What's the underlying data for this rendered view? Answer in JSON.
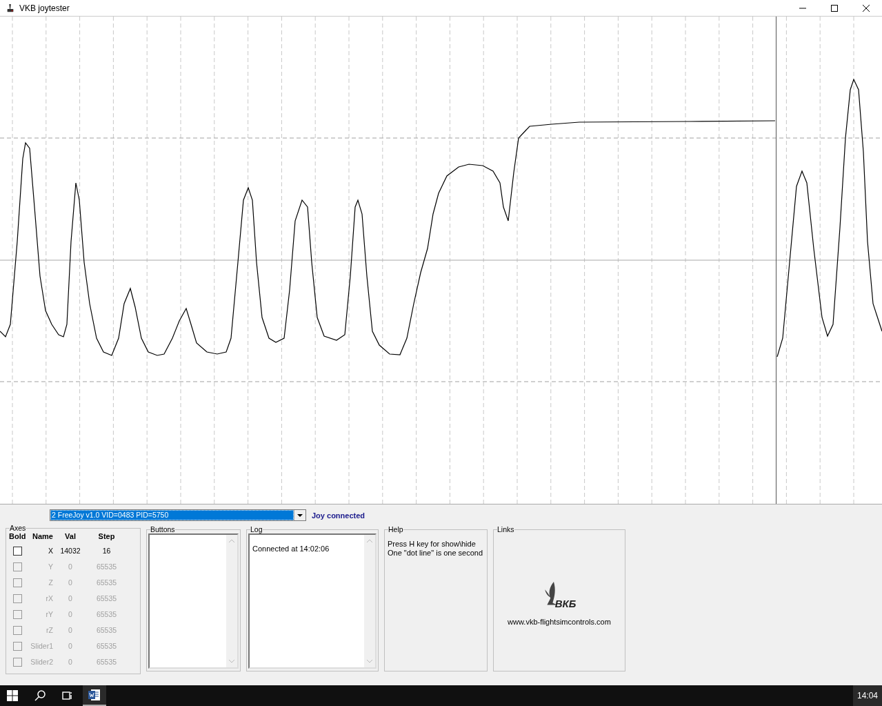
{
  "window": {
    "title": "VKB joytester"
  },
  "device_select": {
    "value": "2 FreeJoy v1.0 VID=0483 PID=5750"
  },
  "status": "Joy connected",
  "axes": {
    "title": "Axes",
    "columns": [
      "Bold",
      "Name",
      "Val",
      "Step"
    ],
    "rows": [
      {
        "name": "X",
        "val": "14032",
        "step": "16",
        "checked": false,
        "disabled": false
      },
      {
        "name": "Y",
        "val": "0",
        "step": "65535",
        "checked": false,
        "disabled": true
      },
      {
        "name": "Z",
        "val": "0",
        "step": "65535",
        "checked": false,
        "disabled": true
      },
      {
        "name": "rX",
        "val": "0",
        "step": "65535",
        "checked": false,
        "disabled": true
      },
      {
        "name": "rY",
        "val": "0",
        "step": "65535",
        "checked": false,
        "disabled": true
      },
      {
        "name": "rZ",
        "val": "0",
        "step": "65535",
        "checked": false,
        "disabled": true
      },
      {
        "name": "Slider1",
        "val": "0",
        "step": "65535",
        "checked": false,
        "disabled": true
      },
      {
        "name": "Slider2",
        "val": "0",
        "step": "65535",
        "checked": false,
        "disabled": true
      }
    ]
  },
  "buttons_panel": {
    "title": "Buttons"
  },
  "log": {
    "title": "Log",
    "lines": [
      "Connected at 14:02:06"
    ]
  },
  "help": {
    "title": "Help",
    "lines": [
      "Press H key for show\\hide",
      "One \"dot line\" is one second"
    ]
  },
  "links": {
    "title": "Links",
    "logo_text": "ВКБ",
    "url": "www.vkb-flightsimcontrols.com"
  },
  "taskbar": {
    "clock": "14:04"
  }
}
